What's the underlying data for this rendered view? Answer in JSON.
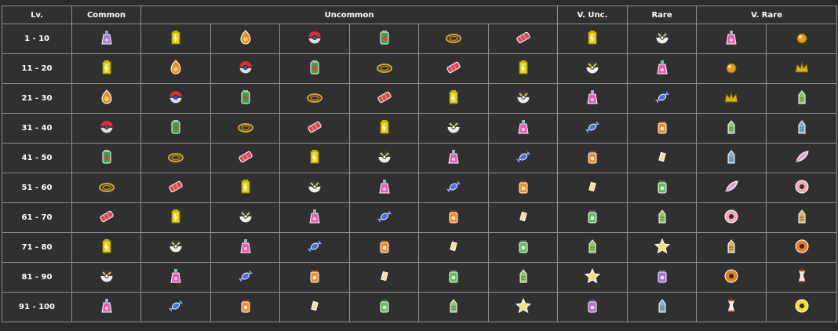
{
  "headers": [
    {
      "label": "Lv.",
      "span": 1
    },
    {
      "label": "Common",
      "span": 1
    },
    {
      "label": "Uncommon",
      "span": 6
    },
    {
      "label": "V. Unc.",
      "span": 1
    },
    {
      "label": "Rare",
      "span": 1
    },
    {
      "label": "V. Rare",
      "span": 2
    }
  ],
  "rows": [
    {
      "level": "1 - 10",
      "items": [
        "potion-icon",
        "energy-icon",
        "fire-stone-icon",
        "pokeball-icon",
        "full-restore-icon",
        "rope-icon",
        "dynamite-icon",
        "energy-icon",
        "ultra-ball-icon",
        "pink-potion-icon",
        "nugget-icon"
      ]
    },
    {
      "level": "11 - 20",
      "items": [
        "energy-icon",
        "fire-stone-icon",
        "pokeball-icon",
        "full-restore-icon",
        "rope-icon",
        "dynamite-icon",
        "energy-icon",
        "ultra-ball-icon",
        "pink-potion-icon",
        "nugget-icon",
        "crown-icon"
      ]
    },
    {
      "level": "21 - 30",
      "items": [
        "fire-stone-icon",
        "pokeball-icon",
        "full-restore-icon",
        "rope-icon",
        "dynamite-icon",
        "energy-icon",
        "ultra-ball-icon",
        "pink-potion-icon",
        "candy-icon",
        "crown-icon",
        "green-figure-icon"
      ]
    },
    {
      "level": "31 - 40",
      "items": [
        "pokeball-icon",
        "full-restore-icon",
        "rope-icon",
        "dynamite-icon",
        "energy-icon",
        "ultra-ball-icon",
        "pink-potion-icon",
        "candy-icon",
        "vitamin-jar-icon",
        "green-figure-icon",
        "teal-figure-icon"
      ]
    },
    {
      "level": "41 - 50",
      "items": [
        "full-restore-icon",
        "rope-icon",
        "dynamite-icon",
        "energy-icon",
        "ultra-ball-icon",
        "pink-potion-icon",
        "candy-icon",
        "vitamin-jar-icon",
        "card-icon",
        "teal-figure-icon",
        "feather-icon"
      ]
    },
    {
      "level": "51 - 60",
      "items": [
        "rope-icon",
        "dynamite-icon",
        "energy-icon",
        "ultra-ball-icon",
        "pink-potion-icon",
        "candy-icon",
        "vitamin-jar-icon",
        "card-icon",
        "green-jar-icon",
        "feather-icon",
        "donut-icon"
      ]
    },
    {
      "level": "61 - 70",
      "items": [
        "dynamite-icon",
        "energy-icon",
        "ultra-ball-icon",
        "pink-potion-icon",
        "candy-icon",
        "vitamin-jar-icon",
        "card-icon",
        "green-jar-icon",
        "green-figure-icon",
        "donut-icon",
        "gold-figure-icon"
      ]
    },
    {
      "level": "71 - 80",
      "items": [
        "energy-icon",
        "ultra-ball-icon",
        "pink-potion-icon",
        "candy-icon",
        "vitamin-jar-icon",
        "card-icon",
        "green-jar-icon",
        "green-figure-icon",
        "star-icon",
        "gold-figure-icon",
        "orange-ring-icon"
      ]
    },
    {
      "level": "81 - 90",
      "items": [
        "ultra-ball-icon",
        "pink-potion-icon",
        "candy-icon",
        "vitamin-jar-icon",
        "card-icon",
        "green-jar-icon",
        "green-figure-icon",
        "star-icon",
        "purple-jar-icon",
        "orange-ring-icon",
        "apple-core-icon"
      ]
    },
    {
      "level": "91 - 100",
      "items": [
        "pink-potion-icon",
        "candy-icon",
        "vitamin-jar-icon",
        "card-icon",
        "green-jar-icon",
        "green-figure-icon",
        "star-icon",
        "purple-jar-icon",
        "teal-figure-icon",
        "apple-core-icon",
        "yellow-ring-icon"
      ]
    }
  ]
}
